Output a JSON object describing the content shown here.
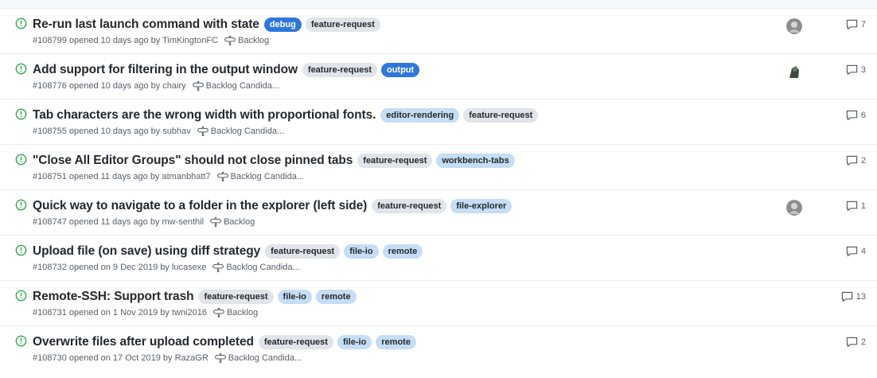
{
  "labels": {
    "debug": {
      "text": "debug",
      "bg": "#2f77d9",
      "fg": "#ffffff"
    },
    "output": {
      "text": "output",
      "bg": "#2f77d9",
      "fg": "#ffffff"
    },
    "feature-request": {
      "text": "feature-request",
      "bg": "#e1e4e8",
      "fg": "#24292e"
    },
    "editor-rendering": {
      "text": "editor-rendering",
      "bg": "#c5ddf5",
      "fg": "#24292e"
    },
    "workbench-tabs": {
      "text": "workbench-tabs",
      "bg": "#c5ddf5",
      "fg": "#24292e"
    },
    "file-explorer": {
      "text": "file-explorer",
      "bg": "#c5ddf5",
      "fg": "#24292e"
    },
    "file-io": {
      "text": "file-io",
      "bg": "#c5ddf5",
      "fg": "#24292e"
    },
    "remote": {
      "text": "remote",
      "bg": "#c5ddf5",
      "fg": "#24292e"
    }
  },
  "colors": {
    "open_icon": "#28a745",
    "muted": "#586069"
  },
  "issues": [
    {
      "title": "Re-run last launch command with state",
      "labels": [
        "debug",
        "feature-request"
      ],
      "meta": "#108799 opened 10 days ago by TimKingtonFC",
      "milestone": "Backlog",
      "comments": "7",
      "avatar": "gray"
    },
    {
      "title": "Add support for filtering in the output window",
      "labels": [
        "feature-request",
        "output"
      ],
      "meta": "#108776 opened 10 days ago by chairy",
      "milestone": "Backlog Candida...",
      "comments": "3",
      "avatar": "dark"
    },
    {
      "title": "Tab characters are the wrong width with proportional fonts.",
      "labels": [
        "editor-rendering",
        "feature-request"
      ],
      "meta": "#108755 opened 10 days ago by subhav",
      "milestone": "Backlog Candida...",
      "comments": "6",
      "avatar": ""
    },
    {
      "title": "\"Close All Editor Groups\" should not close pinned tabs",
      "labels": [
        "feature-request",
        "workbench-tabs"
      ],
      "meta": "#108751 opened 11 days ago by atmanbhatt7",
      "milestone": "Backlog Candida...",
      "comments": "2",
      "avatar": ""
    },
    {
      "title": "Quick way to navigate to a folder in the explorer (left side)",
      "labels": [
        "feature-request",
        "file-explorer"
      ],
      "meta": "#108747 opened 11 days ago by mw-senthil",
      "milestone": "Backlog",
      "comments": "1",
      "avatar": "gray"
    },
    {
      "title": "Upload file (on save) using diff strategy",
      "labels": [
        "feature-request",
        "file-io",
        "remote"
      ],
      "meta": "#108732 opened on 9 Dec 2019 by lucasexe",
      "milestone": "Backlog Candida...",
      "comments": "4",
      "avatar": ""
    },
    {
      "title": "Remote-SSH: Support trash",
      "labels": [
        "feature-request",
        "file-io",
        "remote"
      ],
      "meta": "#108731 opened on 1 Nov 2019 by twni2016",
      "milestone": "Backlog",
      "comments": "13",
      "avatar": ""
    },
    {
      "title": "Overwrite files after upload completed",
      "labels": [
        "feature-request",
        "file-io",
        "remote"
      ],
      "meta": "#108730 opened on 17 Oct 2019 by RazaGR",
      "milestone": "Backlog Candida...",
      "comments": "2",
      "avatar": ""
    }
  ]
}
